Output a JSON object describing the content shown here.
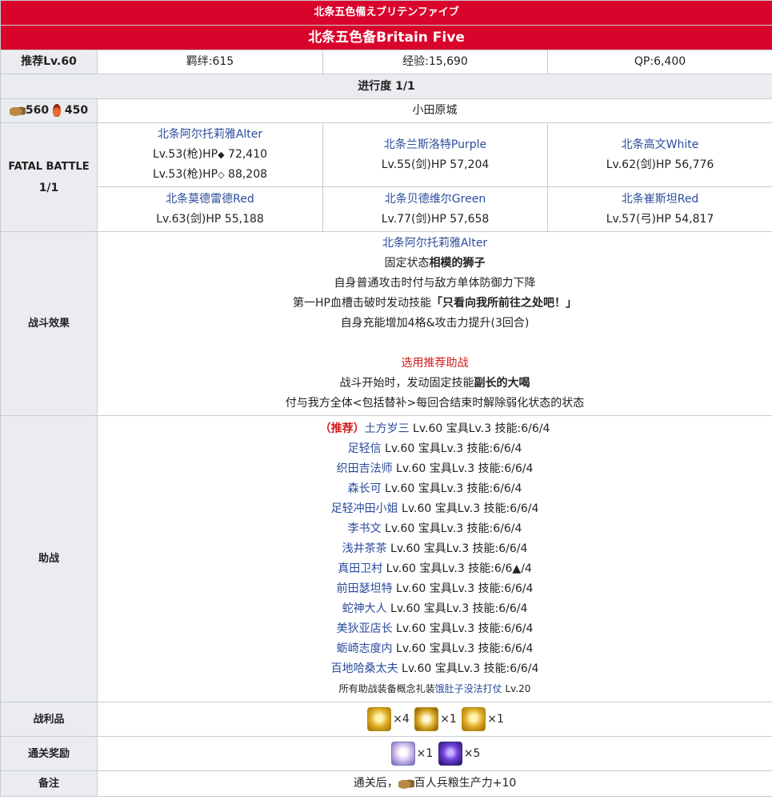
{
  "header": {
    "jp_title": "北条五色備えブリテンファイブ",
    "cn_title": "北条五色备Britain Five"
  },
  "stats": {
    "recommend_level": "推荐Lv.60",
    "bond": "羁绊:615",
    "exp": "经验:15,690",
    "qp": "QP:6,400"
  },
  "progress": "进行度 1/1",
  "cost": {
    "ration_count": "560",
    "flame_count": "450",
    "location": "小田原城"
  },
  "fatal_battle": {
    "label_line1": "FATAL BATTLE",
    "label_line2": "1/1",
    "enemies": [
      {
        "name": "北条阿尔托莉雅Alter",
        "line1_prefix": "Lv.53(枪)HP",
        "line1_mark": "◆",
        "line1_hp": " 72,410",
        "line2_prefix": "Lv.53(枪)HP",
        "line2_mark": "◇",
        "line2_hp": " 88,208"
      },
      {
        "name": "北条兰斯洛特Purple",
        "info": "Lv.55(剑)HP 57,204"
      },
      {
        "name": "北条高文White",
        "info": "Lv.62(剑)HP 56,776"
      },
      {
        "name": "北条莫德雷德Red",
        "info": "Lv.63(剑)HP 55,188"
      },
      {
        "name": "北条贝德维尔Green",
        "info": "Lv.77(剑)HP 57,658"
      },
      {
        "name": "北条崔斯坦Red",
        "info": "Lv.57(弓)HP 54,817"
      }
    ]
  },
  "effects": {
    "label": "战斗效果",
    "target_name": "北条阿尔托莉雅Alter",
    "line1_pre": "固定状态",
    "line1_bold": "相模的狮子",
    "line2": "自身普通攻击时付与敌方单体防御力下降",
    "line3_pre": "第一HP血槽击破时发动技能",
    "line3_bold": "「只看向我所前往之处吧！」",
    "line4": "自身充能增加4格&攻击力提升(3回合)",
    "support_title": "选用推荐助战",
    "line5_pre": "战斗开始时，发动固定技能",
    "line5_bold": "副长的大喝",
    "line6": "付与我方全体<包括替补>每回合结束时解除弱化状态的状态"
  },
  "support": {
    "label": "助战",
    "recommend_tag": "（推荐）",
    "rows": [
      {
        "name": "土方岁三",
        "info": " Lv.60 宝具Lv.3 技能:6/6/4"
      },
      {
        "name": "足轻信",
        "info": " Lv.60 宝具Lv.3 技能:6/6/4"
      },
      {
        "name": "织田吉法师",
        "info": " Lv.60 宝具Lv.3 技能:6/6/4"
      },
      {
        "name": "森长可",
        "info": " Lv.60 宝具Lv.3 技能:6/6/4"
      },
      {
        "name": "足轻冲田小姐",
        "info": " Lv.60 宝具Lv.3 技能:6/6/4"
      },
      {
        "name": "李书文",
        "info": " Lv.60 宝具Lv.3 技能:6/6/4"
      },
      {
        "name": "浅井茶茶",
        "info": " Lv.60 宝具Lv.3 技能:6/6/4"
      },
      {
        "name": "真田卫村",
        "info": " Lv.60 宝具Lv.3 技能:6/6▲/4"
      },
      {
        "name": "前田瑟坦特",
        "info": " Lv.60 宝具Lv.3 技能:6/6/4"
      },
      {
        "name": "蛇神大人",
        "info": " Lv.60 宝具Lv.3 技能:6/6/4"
      },
      {
        "name": "美狄亚店长",
        "info": " Lv.60 宝具Lv.3 技能:6/6/4"
      },
      {
        "name": "蛎崎志度内",
        "info": " Lv.60 宝具Lv.3 技能:6/6/4"
      },
      {
        "name": "百地哈桑太夫",
        "info": " Lv.60 宝具Lv.3 技能:6/6/4"
      }
    ],
    "footer_pre": "所有助战装备概念礼装",
    "footer_link": "饿肚子没法打仗",
    "footer_post": " Lv.20"
  },
  "drops": {
    "label": "战利品",
    "items": [
      {
        "icon": "gold-statue-icon",
        "count": "×4"
      },
      {
        "icon": "gold-relic-icon",
        "count": "×1"
      },
      {
        "icon": "gold-statue-icon",
        "count": "×1"
      }
    ]
  },
  "clear_reward": {
    "label": "通关奖励",
    "items": [
      {
        "icon": "summon-ticket-icon",
        "count": "×1"
      },
      {
        "icon": "saint-quartz-icon",
        "count": "×5"
      }
    ]
  },
  "notes": {
    "label": "备注",
    "text_pre": "通关后，",
    "text_post": "百人兵粮生产力+10"
  }
}
